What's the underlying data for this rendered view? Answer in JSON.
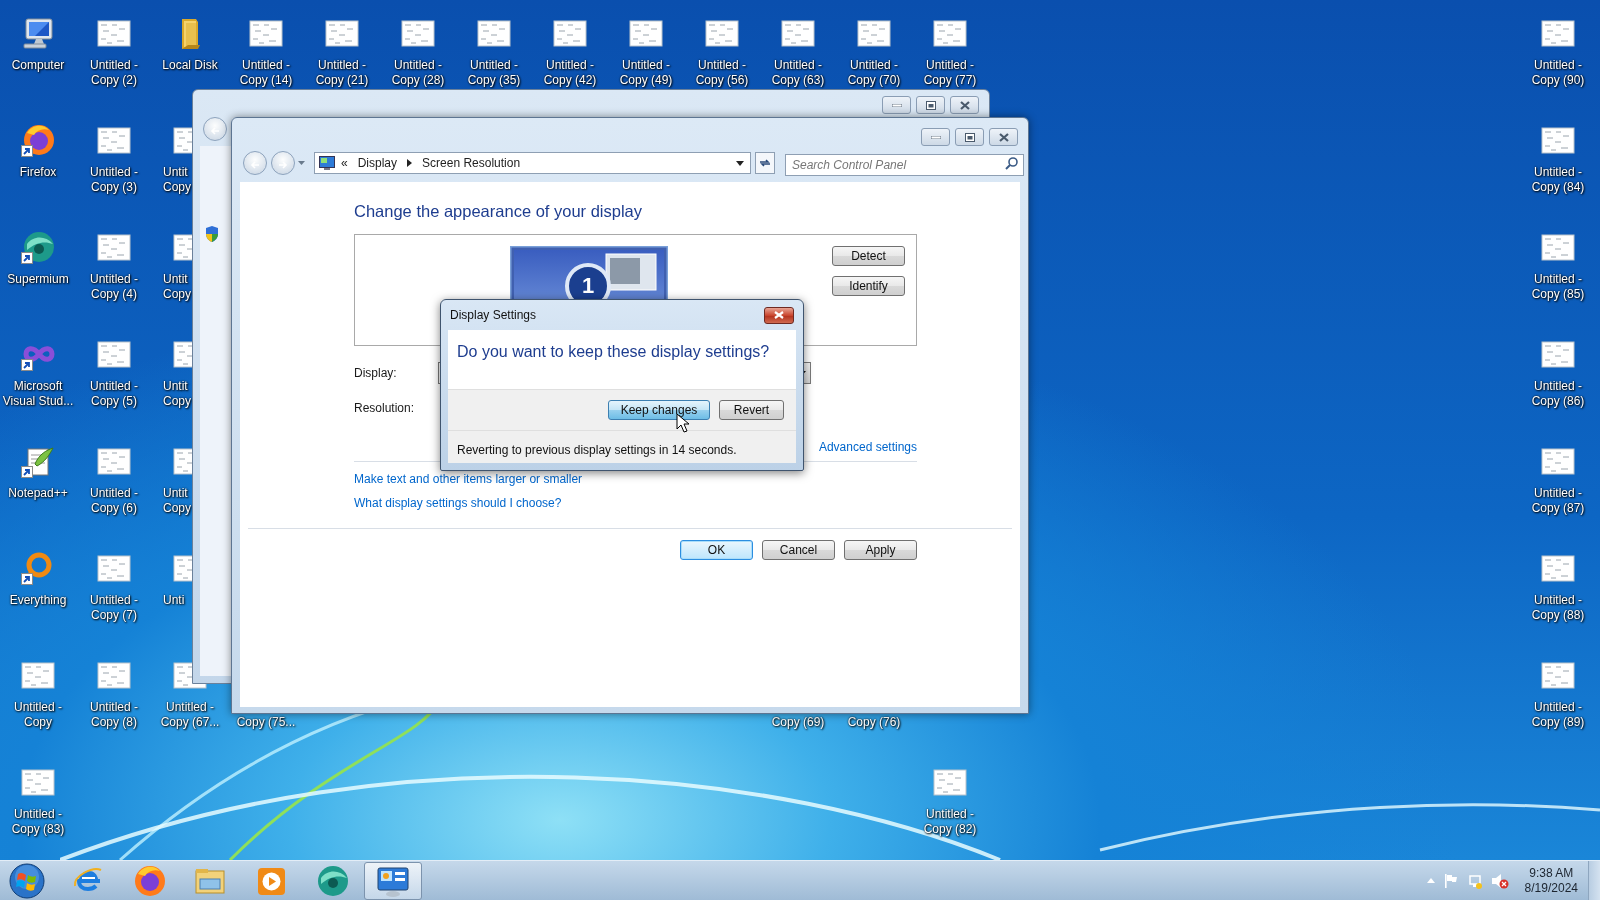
{
  "desktop": {
    "columns": [
      [
        {
          "label": "Computer",
          "kind": "computer",
          "shortcut": false,
          "cut_off": false
        },
        {
          "label": "Firefox",
          "kind": "firefox",
          "shortcut": true,
          "cut_off": false
        },
        {
          "label": "Supermium",
          "kind": "supermium",
          "shortcut": true,
          "cut_off": false
        },
        {
          "label": "Microsoft Visual Stud...",
          "kind": "visual-studio",
          "shortcut": true,
          "cut_off": false
        },
        {
          "label": "Notepad++",
          "kind": "notepad",
          "shortcut": true,
          "cut_off": false
        },
        {
          "label": "Everything",
          "kind": "everything",
          "shortcut": true,
          "cut_off": false
        },
        {
          "label": "Untitled - Copy",
          "kind": "document",
          "shortcut": false,
          "cut_off": false
        },
        {
          "label": "Untitled - Copy (83)",
          "kind": "document",
          "shortcut": false,
          "cut_off": false
        }
      ],
      [
        {
          "label": "Untitled - Copy (2)",
          "kind": "document",
          "shortcut": false,
          "cut_off": false
        },
        {
          "label": "Untitled - Copy (3)",
          "kind": "document",
          "shortcut": false,
          "cut_off": false
        },
        {
          "label": "Untitled - Copy (4)",
          "kind": "document",
          "shortcut": false,
          "cut_off": false
        },
        {
          "label": "Untitled - Copy (5)",
          "kind": "document",
          "shortcut": false,
          "cut_off": false
        },
        {
          "label": "Untitled - Copy (6)",
          "kind": "document",
          "shortcut": false,
          "cut_off": false
        },
        {
          "label": "Untitled - Copy (7)",
          "kind": "document",
          "shortcut": false,
          "cut_off": false
        },
        {
          "label": "Untitled - Copy (8)",
          "kind": "document",
          "shortcut": false,
          "cut_off": false
        }
      ],
      [
        {
          "label": "Local Disk",
          "kind": "folder",
          "shortcut": false,
          "cut_off": false
        },
        {
          "label": "Untit Copy",
          "kind": "document",
          "shortcut": false,
          "cut_off": true
        },
        {
          "label": "Untit Copy",
          "kind": "document",
          "shortcut": false,
          "cut_off": true
        },
        {
          "label": "Untit Copy",
          "kind": "document",
          "shortcut": false,
          "cut_off": true
        },
        {
          "label": "Untit Copy",
          "kind": "document",
          "shortcut": false,
          "cut_off": true
        },
        {
          "label": "Unti",
          "kind": "document",
          "shortcut": false,
          "cut_off": true
        },
        {
          "label": "Untitled - Copy (67...",
          "kind": "document",
          "shortcut": false,
          "cut_off": false
        }
      ],
      [
        {
          "label": "Untitled - Copy (14)",
          "kind": "document",
          "shortcut": false,
          "cut_off": false
        },
        null,
        null,
        null,
        null,
        null,
        {
          "label": "Copy (75...",
          "kind": "label",
          "cut_off": true
        }
      ],
      [
        {
          "label": "Untitled - Copy (21)",
          "kind": "document",
          "shortcut": false,
          "cut_off": false
        }
      ],
      [
        {
          "label": "Untitled - Copy (28)",
          "kind": "document",
          "shortcut": false,
          "cut_off": false
        }
      ],
      [
        {
          "label": "Untitled - Copy (35)",
          "kind": "document",
          "shortcut": false,
          "cut_off": false
        }
      ],
      [
        {
          "label": "Untitled - Copy (42)",
          "kind": "document",
          "shortcut": false,
          "cut_off": false
        }
      ],
      [
        {
          "label": "Untitled - Copy (49)",
          "kind": "document",
          "shortcut": false,
          "cut_off": false
        }
      ],
      [
        {
          "label": "Untitled - Copy (56)",
          "kind": "document",
          "shortcut": false,
          "cut_off": false
        }
      ],
      [
        {
          "label": "Untitled - Copy (63)",
          "kind": "document",
          "shortcut": false,
          "cut_off": false
        },
        null,
        null,
        null,
        null,
        null,
        {
          "label": "Copy (69)",
          "kind": "label",
          "cut_off": true
        }
      ],
      [
        {
          "label": "Untitled - Copy (70)",
          "kind": "document",
          "shortcut": false,
          "cut_off": false
        },
        null,
        null,
        null,
        null,
        null,
        {
          "label": "Copy (76)",
          "kind": "label",
          "cut_off": true
        }
      ],
      [
        {
          "label": "Untitled - Copy (77)",
          "kind": "document",
          "shortcut": false,
          "cut_off": false
        },
        null,
        null,
        null,
        null,
        null,
        null,
        {
          "label": "Untitled - Copy (82)",
          "kind": "document",
          "shortcut": false,
          "cut_off": false
        }
      ]
    ],
    "right_column": [
      {
        "label": "Untitled - Copy (90)",
        "kind": "document",
        "shortcut": false,
        "cut_off": false
      },
      {
        "label": "Untitled - Copy (84)",
        "kind": "document",
        "shortcut": false,
        "cut_off": false
      },
      {
        "label": "Untitled - Copy (85)",
        "kind": "document",
        "shortcut": false,
        "cut_off": false
      },
      {
        "label": "Untitled - Copy (86)",
        "kind": "document",
        "shortcut": false,
        "cut_off": false
      },
      {
        "label": "Untitled - Copy (87)",
        "kind": "document",
        "shortcut": false,
        "cut_off": false
      },
      {
        "label": "Untitled - Copy (88)",
        "kind": "document",
        "shortcut": false,
        "cut_off": false
      },
      {
        "label": "Untitled - Copy (89)",
        "kind": "document",
        "shortcut": false,
        "cut_off": false
      }
    ]
  },
  "window": {
    "address": {
      "prefix": "«",
      "breadcrumb": [
        "Display",
        "Screen Resolution"
      ]
    },
    "search": {
      "placeholder": "Search Control Panel"
    },
    "heading": "Change the appearance of your display",
    "monitor": {
      "number": "1"
    },
    "side_buttons": [
      "Detect",
      "Identify"
    ],
    "fields": [
      {
        "label": "Display:",
        "dropdown": true
      },
      {
        "label": "Resolution:",
        "dropdown": false
      }
    ],
    "advanced_link": "Advanced settings",
    "links": [
      "Make text and other items larger or smaller",
      "What display settings should I choose?"
    ],
    "buttons": [
      {
        "label": "OK",
        "default": true
      },
      {
        "label": "Cancel",
        "default": false
      },
      {
        "label": "Apply",
        "default": false
      }
    ]
  },
  "dialog": {
    "title": "Display Settings",
    "question": "Do you want to keep these display settings?",
    "buttons": [
      {
        "label": "Keep changes",
        "focused": true
      },
      {
        "label": "Revert",
        "focused": false
      }
    ],
    "message": "Reverting to previous display settings in 14 seconds."
  },
  "taskbar": {
    "items": [
      {
        "kind": "internet-explorer",
        "active": false
      },
      {
        "kind": "firefox",
        "active": false
      },
      {
        "kind": "explorer",
        "active": false
      },
      {
        "kind": "media-player",
        "active": false
      },
      {
        "kind": "supermium",
        "active": false
      },
      {
        "kind": "control-panel",
        "active": true
      }
    ],
    "clock": {
      "time": "9:38 AM",
      "date": "8/19/2024"
    }
  }
}
